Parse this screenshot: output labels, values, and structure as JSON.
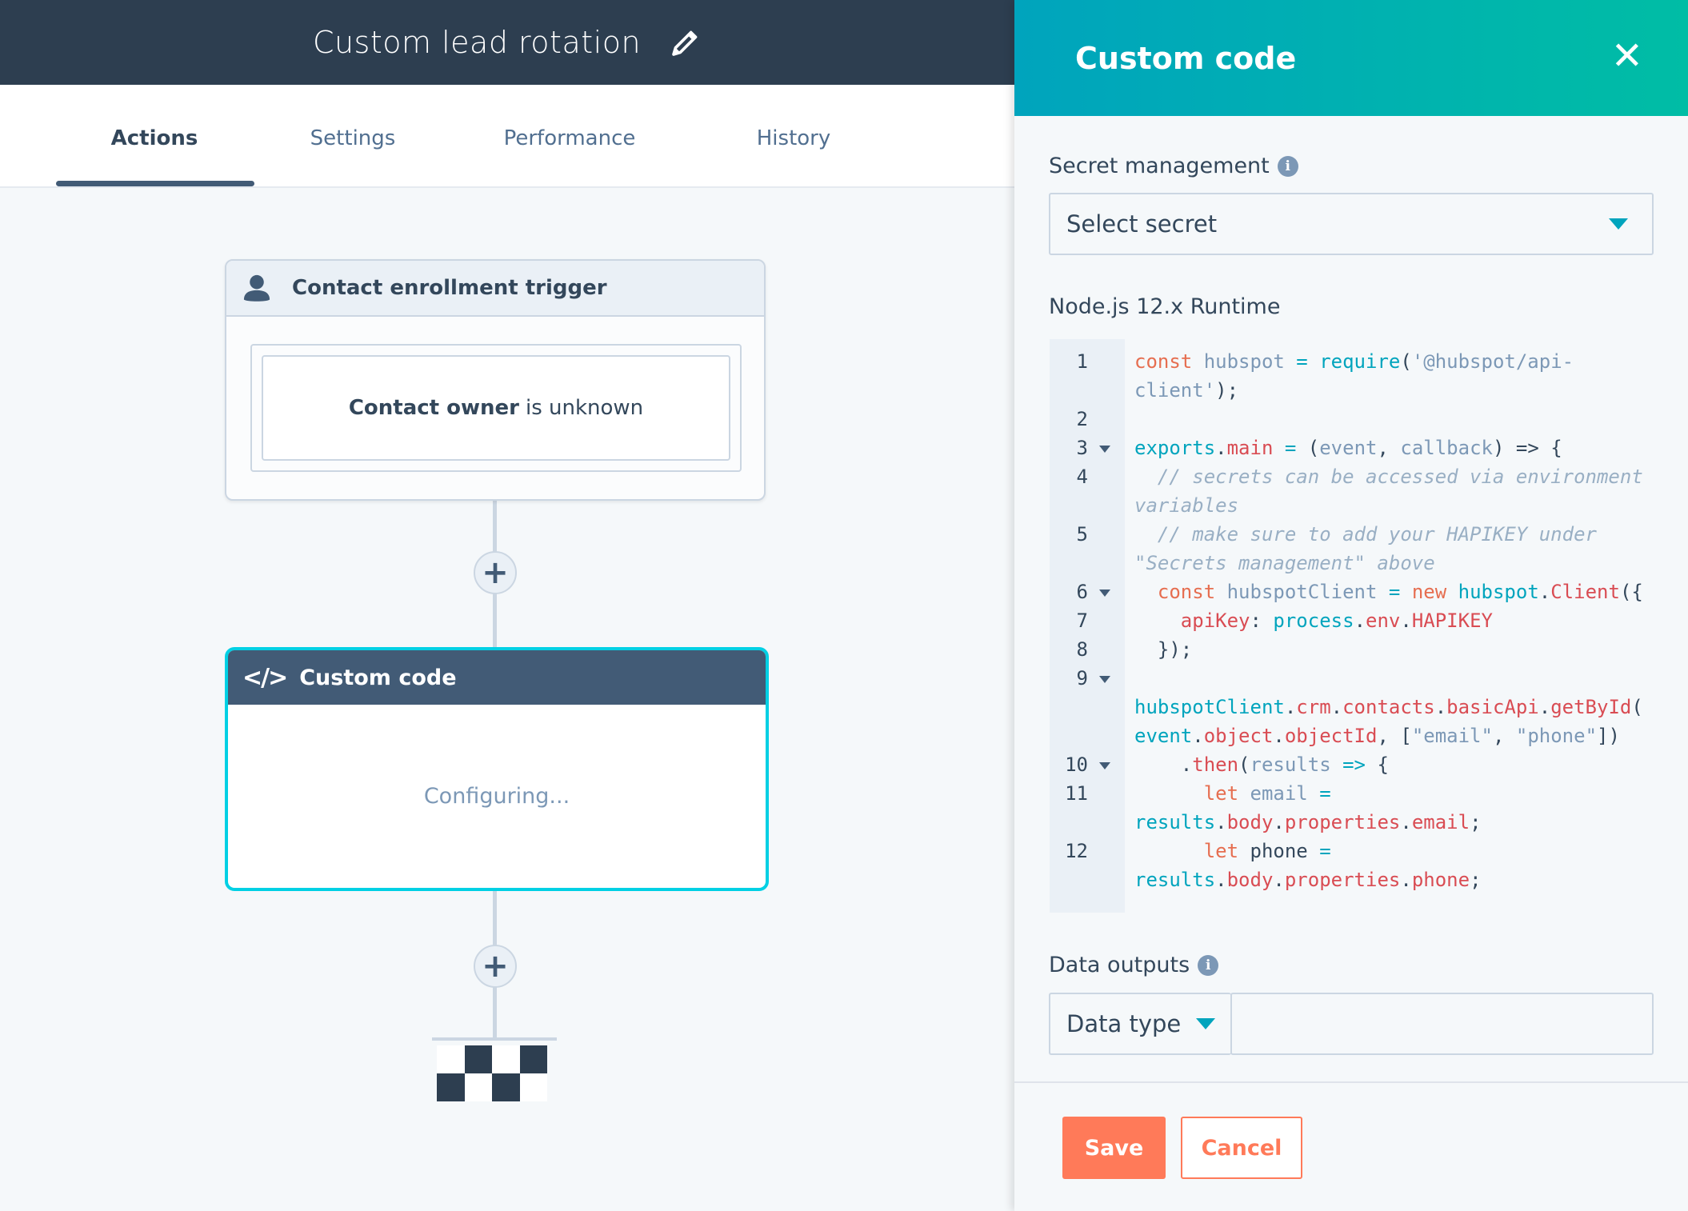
{
  "header": {
    "title": "Custom lead rotation",
    "edit_icon": "pencil-icon"
  },
  "tabs": [
    {
      "label": "Actions",
      "active": true
    },
    {
      "label": "Settings"
    },
    {
      "label": "Performance"
    },
    {
      "label": "History"
    }
  ],
  "workflow": {
    "trigger": {
      "title": "Contact enrollment trigger",
      "condition_bold": "Contact owner",
      "condition_rest": "is unknown",
      "icon": "person-icon"
    },
    "action": {
      "title": "Custom code",
      "status": "Configuring...",
      "icon": "code-icon"
    },
    "add_icon": "plus-icon",
    "end_icon": "checkered-flag-icon"
  },
  "panel": {
    "title": "Custom code",
    "secret_label": "Secret management",
    "secret_select": "Select secret",
    "runtime_label": "Node.js 12.x Runtime",
    "code_lines": [
      {
        "n": "1",
        "fold": false,
        "seg": [
          [
            "const",
            "k"
          ],
          [
            " hubspot ",
            "v"
          ],
          [
            "=",
            "f"
          ],
          [
            " ",
            "d"
          ],
          [
            "require",
            "f"
          ],
          [
            "(",
            "d"
          ],
          [
            "'@hubspot/api-client'",
            "v"
          ],
          [
            ");",
            "d"
          ]
        ]
      },
      {
        "n": "2",
        "fold": false,
        "seg": []
      },
      {
        "n": "3",
        "fold": true,
        "seg": [
          [
            "exports",
            "f"
          ],
          [
            ".",
            "d"
          ],
          [
            "main",
            "p"
          ],
          [
            " ",
            "d"
          ],
          [
            "=",
            "f"
          ],
          [
            " (",
            "d"
          ],
          [
            "event",
            "v"
          ],
          [
            ", ",
            "d"
          ],
          [
            "callback",
            "v"
          ],
          [
            ") => {",
            "d"
          ]
        ]
      },
      {
        "n": "4",
        "fold": false,
        "seg": [
          [
            "  // secrets can be accessed via environment variables",
            "c"
          ]
        ]
      },
      {
        "n": "5",
        "fold": false,
        "seg": [
          [
            "  // make sure to add your HAPIKEY under \"Secrets management\" above",
            "c"
          ]
        ]
      },
      {
        "n": "6",
        "fold": true,
        "seg": [
          [
            "  ",
            "d"
          ],
          [
            "const",
            "k"
          ],
          [
            " hubspotClient ",
            "v"
          ],
          [
            "=",
            "f"
          ],
          [
            " ",
            "d"
          ],
          [
            "new",
            "k"
          ],
          [
            " ",
            "d"
          ],
          [
            "hubspot",
            "f"
          ],
          [
            ".",
            "d"
          ],
          [
            "Client",
            "p"
          ],
          [
            "({",
            "d"
          ]
        ]
      },
      {
        "n": "7",
        "fold": false,
        "seg": [
          [
            "    ",
            "d"
          ],
          [
            "apiKey",
            "p"
          ],
          [
            ": ",
            "d"
          ],
          [
            "process",
            "f"
          ],
          [
            ".",
            "d"
          ],
          [
            "env",
            "p"
          ],
          [
            ".",
            "d"
          ],
          [
            "HAPIKEY",
            "p"
          ]
        ]
      },
      {
        "n": "8",
        "fold": false,
        "seg": [
          [
            "  });",
            "d"
          ]
        ]
      },
      {
        "n": "9",
        "fold": true,
        "seg": [
          [
            "    ",
            "d"
          ],
          [
            "hubspotClient",
            "f"
          ],
          [
            ".",
            "d"
          ],
          [
            "crm",
            "p"
          ],
          [
            ".",
            "d"
          ],
          [
            "contacts",
            "p"
          ],
          [
            ".",
            "d"
          ],
          [
            "basicApi",
            "p"
          ],
          [
            ".",
            "d"
          ],
          [
            "getById",
            "p"
          ],
          [
            "(",
            "d"
          ],
          [
            "event",
            "f"
          ],
          [
            ".",
            "d"
          ],
          [
            "object",
            "p"
          ],
          [
            ".",
            "d"
          ],
          [
            "objectId",
            "p"
          ],
          [
            ", [",
            "d"
          ],
          [
            "\"email\"",
            "v"
          ],
          [
            ", ",
            "d"
          ],
          [
            "\"phone\"",
            "v"
          ],
          [
            "])",
            "d"
          ]
        ]
      },
      {
        "n": "10",
        "fold": true,
        "seg": [
          [
            "    .",
            "d"
          ],
          [
            "then",
            "p"
          ],
          [
            "(",
            "d"
          ],
          [
            "results",
            "v"
          ],
          [
            " ",
            "d"
          ],
          [
            "=>",
            "f"
          ],
          [
            " {",
            "d"
          ]
        ]
      },
      {
        "n": "11",
        "fold": false,
        "seg": [
          [
            "      ",
            "d"
          ],
          [
            "let",
            "k"
          ],
          [
            " email ",
            "v"
          ],
          [
            "=",
            "f"
          ],
          [
            " ",
            "d"
          ],
          [
            "results",
            "f"
          ],
          [
            ".",
            "d"
          ],
          [
            "body",
            "p"
          ],
          [
            ".",
            "d"
          ],
          [
            "properties",
            "p"
          ],
          [
            ".",
            "d"
          ],
          [
            "email",
            "p"
          ],
          [
            ";",
            "d"
          ]
        ]
      },
      {
        "n": "12",
        "fold": false,
        "seg": [
          [
            "      ",
            "d"
          ],
          [
            "let",
            "k"
          ],
          [
            " phone ",
            "d"
          ],
          [
            "=",
            "f"
          ],
          [
            " ",
            "d"
          ],
          [
            "results",
            "f"
          ],
          [
            ".",
            "d"
          ],
          [
            "body",
            "p"
          ],
          [
            ".",
            "d"
          ],
          [
            "properties",
            "p"
          ],
          [
            ".",
            "d"
          ],
          [
            "phone",
            "p"
          ],
          [
            ";",
            "d"
          ]
        ]
      }
    ],
    "outputs_label": "Data outputs",
    "data_type_select": "Data type",
    "save_label": "Save",
    "cancel_label": "Cancel",
    "colors": {
      "header_gradient": [
        "#00a4bd",
        "#00bda5"
      ],
      "save": "#ff7a59",
      "accent": "#00d0e4"
    }
  }
}
